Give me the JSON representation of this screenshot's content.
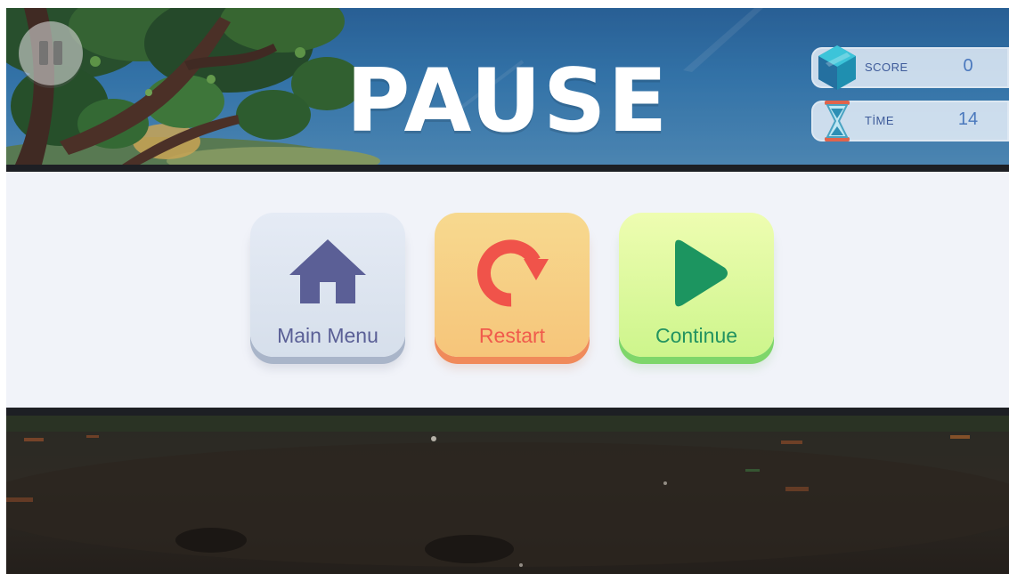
{
  "screen": {
    "title": "PAUSE"
  },
  "hud": {
    "score": {
      "label": "SCORE",
      "value": "0",
      "icon": "cube-gem-icon"
    },
    "time": {
      "label": "TİME",
      "value": "14",
      "icon": "hourglass-icon"
    }
  },
  "pause_button": {
    "icon": "pause-icon"
  },
  "menu": {
    "buttons": [
      {
        "label": "Main Menu",
        "icon": "home-icon",
        "color": "#5a5f96"
      },
      {
        "label": "Restart",
        "icon": "restart-icon",
        "color": "#f05a4c"
      },
      {
        "label": "Continue",
        "icon": "play-icon",
        "color": "#229360"
      }
    ]
  }
}
